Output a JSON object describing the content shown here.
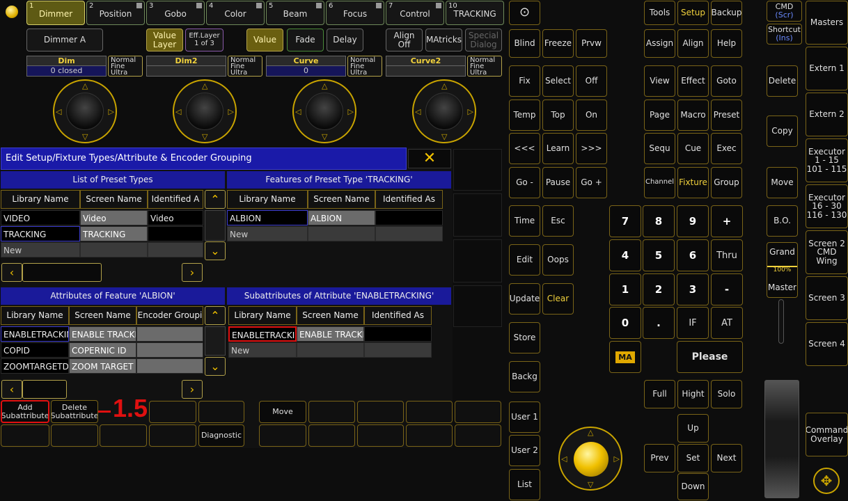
{
  "preset_tabs": [
    {
      "num": "1",
      "label": "Dimmer"
    },
    {
      "num": "2",
      "label": "Position"
    },
    {
      "num": "3",
      "label": "Gobo"
    },
    {
      "num": "4",
      "label": "Color"
    },
    {
      "num": "5",
      "label": "Beam"
    },
    {
      "num": "6",
      "label": "Focus"
    },
    {
      "num": "7",
      "label": "Control"
    },
    {
      "num": "10",
      "label": "TRACKING"
    }
  ],
  "toolbar": {
    "dimmer_a": "Dimmer A",
    "value_layer": "Value\nLayer",
    "eff_layer": "Eff.Layer\n1 of 3",
    "value": "Value",
    "fade": "Fade",
    "delay": "Delay",
    "align_off": "Align\nOff",
    "matricks": "MAtricks",
    "special_dialog": "Special\nDialog"
  },
  "encoders": [
    {
      "name": "Dim",
      "value": "0 closed",
      "mode": "Normal\nFine\nUltra"
    },
    {
      "name": "Dim2",
      "value": "",
      "mode": "Normal\nFine\nUltra"
    },
    {
      "name": "Curve",
      "value": "0",
      "mode": "Normal\nFine\nUltra"
    },
    {
      "name": "Curve2",
      "value": "",
      "mode": "Normal\nFine\nUltra"
    }
  ],
  "window": {
    "title": "Edit Setup/Fixture Types/Attribute & Encoder Grouping",
    "close": "✕"
  },
  "preset_types": {
    "title": "List of Preset Types",
    "cols": [
      "Library Name",
      "Screen Name",
      "Identified A"
    ],
    "rows": [
      [
        "VIDEO",
        "Video",
        "Video"
      ],
      [
        "TRACKING",
        "TRACKING",
        ""
      ],
      [
        "New",
        "",
        ""
      ]
    ]
  },
  "features": {
    "title": "Features of Preset Type 'TRACKING'",
    "cols": [
      "Library Name",
      "Screen Name",
      "Identified As"
    ],
    "rows": [
      [
        "ALBION",
        "ALBION",
        ""
      ],
      [
        "New",
        "",
        ""
      ]
    ]
  },
  "attributes": {
    "title": "Attributes of Feature 'ALBION'",
    "cols": [
      "Library Name",
      "Screen Name",
      "Encoder Groupi"
    ],
    "rows": [
      [
        "ENABLETRACKIN",
        "ENABLE TRACKI",
        ""
      ],
      [
        "COPID",
        "COPERNIC ID",
        ""
      ],
      [
        "ZOOMTARGETDI",
        "ZOOM TARGET D",
        ""
      ]
    ]
  },
  "subattributes": {
    "title": "Subattributes of Attribute 'ENABLETRACKING'",
    "cols": [
      "Library Name",
      "Screen Name",
      "Identified As"
    ],
    "rows": [
      [
        "ENABLETRACKIN",
        "ENABLE TRACKI",
        ""
      ],
      [
        "New",
        "",
        ""
      ]
    ]
  },
  "bottom": {
    "add": "Add\nSubattribute",
    "delete": "Delete\nSubattribute",
    "move": "Move",
    "diagnostic": "Diagnostic",
    "callout": "1.5"
  },
  "col1": {
    "circle": "⊙",
    "blind": "Blind",
    "fix": "Fix",
    "temp": "Temp",
    "prev": "<<<",
    "go_minus": "Go -",
    "time": "Time",
    "edit": "Edit",
    "update": "Update",
    "store": "Store",
    "backg": "Backg",
    "user1": "User 1",
    "user2": "User 2",
    "list": "List"
  },
  "col2": {
    "freeze": "Freeze",
    "select": "Select",
    "top": "Top",
    "learn": "Learn",
    "pause": "Pause",
    "esc": "Esc",
    "oops": "Oops",
    "clear": "Clear"
  },
  "col3": {
    "prvw": "Prvw",
    "off": "Off",
    "on": "On",
    "next": ">>>",
    "go_plus": "Go +"
  },
  "right": {
    "tools": "Tools",
    "setup": "Setup",
    "backup": "Backup",
    "assign": "Assign",
    "align": "Align",
    "help": "Help",
    "view": "View",
    "effect": "Effect",
    "goto": "Goto",
    "page": "Page",
    "macro": "Macro",
    "preset": "Preset",
    "sequ": "Sequ",
    "cue": "Cue",
    "exec": "Exec",
    "channel": "Channel",
    "fixture": "Fixture",
    "group": "Group"
  },
  "keypad": {
    "k7": "7",
    "k8": "8",
    "k9": "9",
    "plus": "+",
    "k4": "4",
    "k5": "5",
    "k6": "6",
    "thru": "Thru",
    "k1": "1",
    "k2": "2",
    "k3": "3",
    "minus": "-",
    "k0": "0",
    "dot": ".",
    "if": "IF",
    "at": "AT",
    "ma": "MA",
    "please": "Please",
    "full": "Full",
    "hight": "Hight",
    "solo": "Solo",
    "up": "Up",
    "prev": "Prev",
    "set": "Set",
    "next": "Next",
    "down": "Down"
  },
  "far_right": {
    "cmd": "CMD",
    "scr": "(Scr)",
    "shortcut": "Shortcut",
    "ins": "(Ins)",
    "delete": "Delete",
    "copy": "Copy",
    "move": "Move",
    "bo": "B.O.",
    "grand": "Grand",
    "pct": "100%",
    "master": "Master"
  },
  "masters": {
    "masters": "Masters",
    "extern1": "Extern 1",
    "extern2": "Extern 2",
    "exec1": "Executor\n1 - 15\n101 - 115",
    "exec2": "Executor\n16 - 30\n116 - 130",
    "screen2": "Screen 2\nCMD Wing",
    "screen3": "Screen 3",
    "screen4": "Screen 4",
    "cmd_overlay": "Command\nOverlay"
  }
}
